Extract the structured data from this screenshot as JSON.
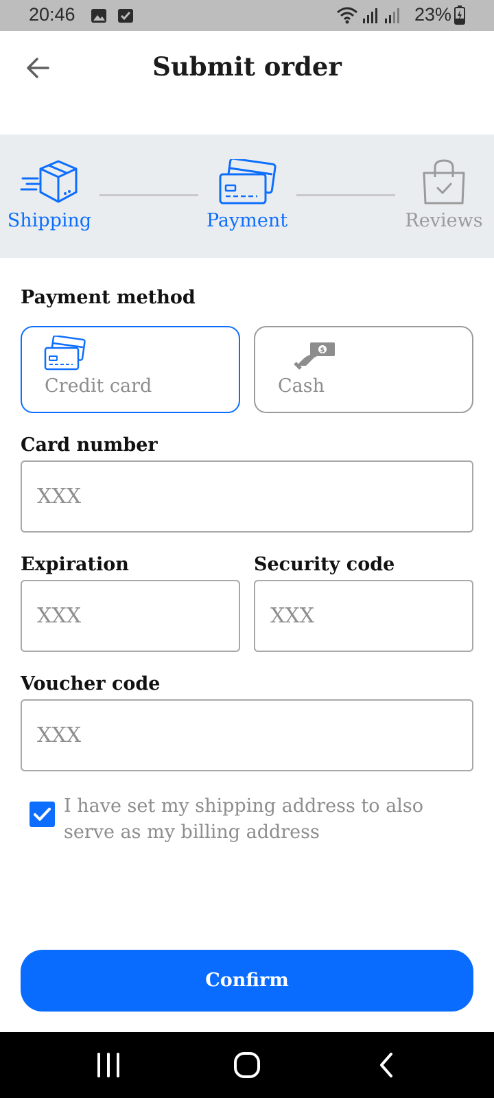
{
  "status_bar": {
    "time": "20:46",
    "battery": "23%",
    "icons": [
      "image-icon",
      "check-square-icon",
      "wifi-icon",
      "signal-icon",
      "signal-icon",
      "battery-charging-icon"
    ]
  },
  "header": {
    "title": "Submit order",
    "back_icon": "arrow-left-icon"
  },
  "stepper": {
    "steps": [
      {
        "label": "Shipping",
        "icon": "delivery-box-icon",
        "state": "done"
      },
      {
        "label": "Payment",
        "icon": "credit-cards-icon",
        "state": "active"
      },
      {
        "label": "Reviews",
        "icon": "shopping-bag-check-icon",
        "state": "inactive"
      }
    ],
    "colors": {
      "active": "#0d6efd",
      "inactive": "#9a9a9a"
    }
  },
  "payment": {
    "section_label": "Payment method",
    "methods": [
      {
        "label": "Credit card",
        "icon": "credit-cards-icon",
        "selected": true
      },
      {
        "label": "Cash",
        "icon": "hand-cash-icon",
        "selected": false
      }
    ]
  },
  "fields": {
    "card_number": {
      "label": "Card number",
      "placeholder": "XXX",
      "value": ""
    },
    "expiration": {
      "label": "Expiration",
      "placeholder": "XXX",
      "value": ""
    },
    "security_code": {
      "label": "Security code",
      "placeholder": "XXX",
      "value": ""
    },
    "voucher_code": {
      "label": "Voucher code",
      "placeholder": "XXX",
      "value": ""
    }
  },
  "billing_checkbox": {
    "checked": true,
    "label": "I have set my shipping address to also serve as my billing address"
  },
  "confirm_label": "Confirm",
  "nav_bar": {
    "icons": [
      "recent-apps-icon",
      "home-icon",
      "back-icon"
    ]
  },
  "colors": {
    "accent": "#0d6efd",
    "confirm": "#0a6cff",
    "stepper_bg": "#eaedf0",
    "status_bar_bg": "#bdbdbd"
  }
}
